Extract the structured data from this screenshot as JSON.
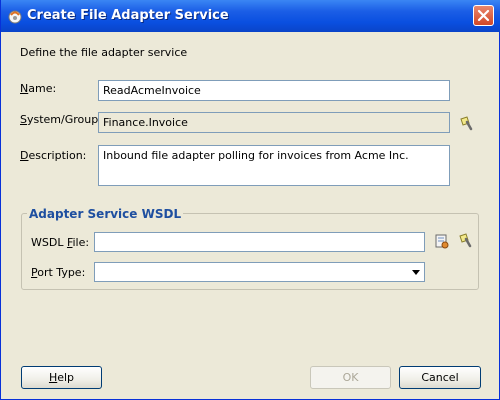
{
  "window": {
    "title": "Create File Adapter Service",
    "close_label": "×"
  },
  "intro": "Define the file adapter service",
  "name": {
    "label": "Name:",
    "mnemonic": "N",
    "label_rest": "ame:",
    "value": "ReadAcmeInvoice"
  },
  "system_group": {
    "label": "System/Group:",
    "mnemonic": "S",
    "label_rest": "ystem/Group:",
    "value": "Finance.Invoice"
  },
  "description": {
    "label": "Description:",
    "mnemonic": "D",
    "label_rest": "escription:",
    "value": "Inbound file adapter polling for invoices from Acme Inc."
  },
  "wsdl_group": {
    "title": "Adapter Service WSDL",
    "wsdl_file": {
      "label": "WSDL File:",
      "label_pre": "WSDL ",
      "mnemonic": "F",
      "label_rest": "ile:",
      "value": ""
    },
    "port_type": {
      "label": "Port Type:",
      "label_pre": "",
      "mnemonic": "P",
      "label_rest": "ort Type:",
      "value": ""
    }
  },
  "buttons": {
    "help": "Help",
    "help_mnemonic": "H",
    "help_rest": "elp",
    "ok": "OK",
    "cancel": "Cancel"
  },
  "icons": {
    "title": "oracle-jdeveloper-icon",
    "browse": "flashlight-icon",
    "wsdl_browse": "wsdl-chooser-icon"
  },
  "colors": {
    "titlebar": "#0a4fe0",
    "dialog_bg": "#ece9d8",
    "group_title": "#1e4fa0",
    "field_border": "#7f9db9"
  }
}
